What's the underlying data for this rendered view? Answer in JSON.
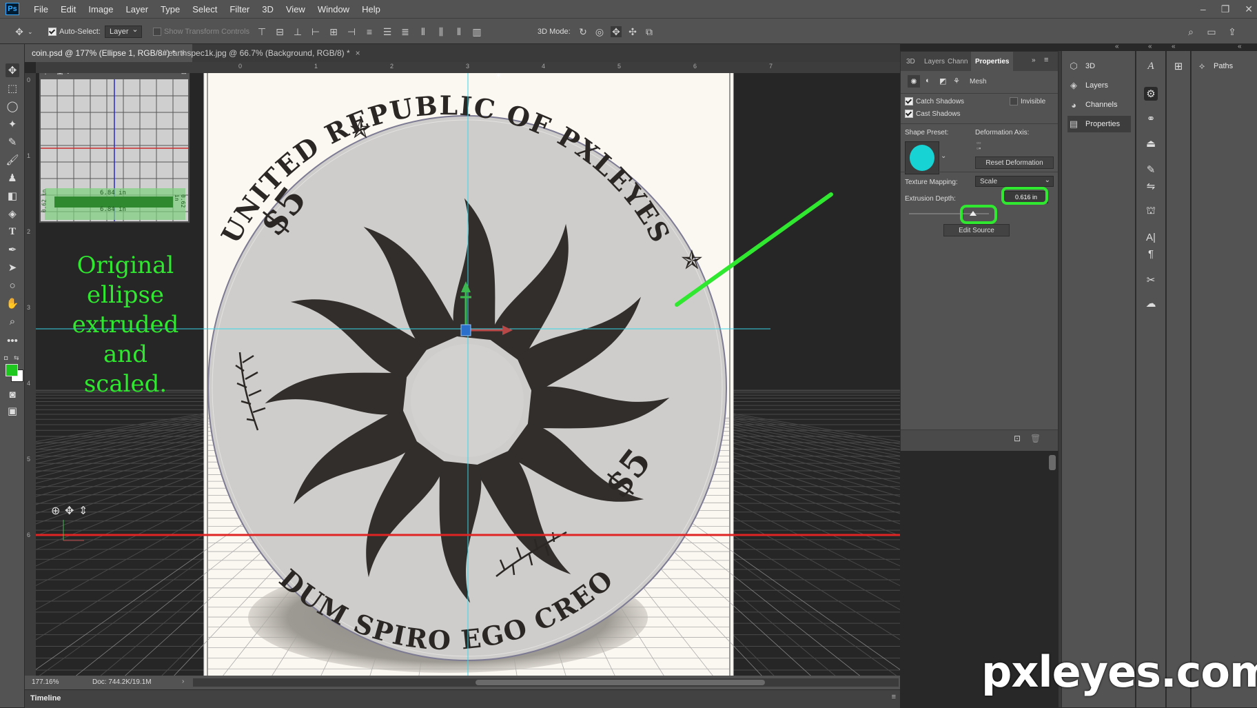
{
  "app": {
    "logo": "Ps"
  },
  "menu": [
    "File",
    "Edit",
    "Image",
    "Layer",
    "Type",
    "Select",
    "Filter",
    "3D",
    "View",
    "Window",
    "Help"
  ],
  "window_controls": {
    "minimize": "–",
    "restore": "❐",
    "close": "✕"
  },
  "options_bar": {
    "auto_select_label": "Auto-Select:",
    "auto_select_value": "Layer",
    "show_transform_label": "Show Transform Controls",
    "mode_3d_label": "3D Mode:"
  },
  "doc_tabs": [
    {
      "label": "coin.psd @ 177% (Ellipse 1, RGB/8#) *"
    },
    {
      "label": "earthspec1k.jpg @ 66.7% (Background, RGB/8) *"
    }
  ],
  "tab_close": "×",
  "ruler": {
    "h": [
      "0",
      "1",
      "2",
      "3",
      "4",
      "5",
      "6",
      "7"
    ],
    "v": [
      "0",
      "1",
      "2",
      "3",
      "4",
      "5",
      "6"
    ]
  },
  "minimap": {
    "width_label": "6.84 in",
    "height_label": "0.62 in"
  },
  "annotation": {
    "lines": [
      "Original ellipse",
      "extruded and",
      "scaled."
    ]
  },
  "coin": {
    "top_text": "UNITED REPUBLIC OF PXLEYES",
    "bottom_text": "DUM SPIRO EGO CREO",
    "value": "$5"
  },
  "status": {
    "zoom": "177.16%",
    "doc": "Doc: 744.2K/19.1M"
  },
  "timeline": {
    "label": "Timeline"
  },
  "properties": {
    "tabs": [
      "3D",
      "Layers",
      "Chann",
      "Properties"
    ],
    "mesh_label": "Mesh",
    "catch_shadows": "Catch Shadows",
    "invisible": "Invisible",
    "cast_shadows": "Cast Shadows",
    "shape_preset": "Shape Preset:",
    "deformation_axis": "Deformation Axis:",
    "reset_deformation": "Reset Deformation",
    "texture_mapping": "Texture Mapping:",
    "texture_mapping_value": "Scale",
    "extrusion_depth": "Extrusion Depth:",
    "extrusion_value": "0.616 in",
    "extrusion_fraction": 0.8,
    "edit_source": "Edit Source"
  },
  "dock_panels": [
    "3D",
    "Layers",
    "Channels",
    "Properties"
  ],
  "paths_panel": "Paths",
  "watermark": "pxleyes.com",
  "colors": {
    "highlight": "#2fe82f",
    "preset_swatch": "#17d3d3",
    "foreground": "#1ec81e"
  }
}
